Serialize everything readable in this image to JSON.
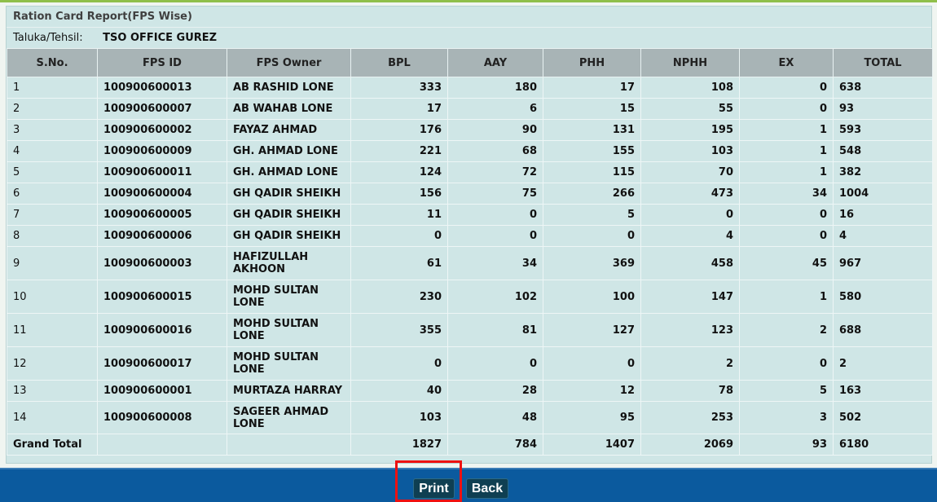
{
  "report": {
    "title": "Ration Card Report(FPS Wise)",
    "taluka_label": "Taluka/Tehsil:",
    "taluka_value": "TSO OFFICE GUREZ"
  },
  "table": {
    "headers": [
      "S.No.",
      "FPS ID",
      "FPS Owner",
      "BPL",
      "AAY",
      "PHH",
      "NPHH",
      "EX",
      "TOTAL"
    ],
    "rows": [
      [
        "1",
        "100900600013",
        "AB RASHID LONE",
        "333",
        "180",
        "17",
        "108",
        "0",
        "638"
      ],
      [
        "2",
        "100900600007",
        "AB WAHAB LONE",
        "17",
        "6",
        "15",
        "55",
        "0",
        "93"
      ],
      [
        "3",
        "100900600002",
        "FAYAZ AHMAD",
        "176",
        "90",
        "131",
        "195",
        "1",
        "593"
      ],
      [
        "4",
        "100900600009",
        "GH. AHMAD LONE",
        "221",
        "68",
        "155",
        "103",
        "1",
        "548"
      ],
      [
        "5",
        "100900600011",
        "GH. AHMAD LONE",
        "124",
        "72",
        "115",
        "70",
        "1",
        "382"
      ],
      [
        "6",
        "100900600004",
        "GH QADIR SHEIKH",
        "156",
        "75",
        "266",
        "473",
        "34",
        "1004"
      ],
      [
        "7",
        "100900600005",
        "GH QADIR SHEIKH",
        "11",
        "0",
        "5",
        "0",
        "0",
        "16"
      ],
      [
        "8",
        "100900600006",
        "GH QADIR SHEIKH",
        "0",
        "0",
        "0",
        "4",
        "0",
        "4"
      ],
      [
        "9",
        "100900600003",
        "HAFIZULLAH AKHOON",
        "61",
        "34",
        "369",
        "458",
        "45",
        "967"
      ],
      [
        "10",
        "100900600015",
        "MOHD SULTAN LONE",
        "230",
        "102",
        "100",
        "147",
        "1",
        "580"
      ],
      [
        "11",
        "100900600016",
        "MOHD SULTAN LONE",
        "355",
        "81",
        "127",
        "123",
        "2",
        "688"
      ],
      [
        "12",
        "100900600017",
        "MOHD SULTAN LONE",
        "0",
        "0",
        "0",
        "2",
        "0",
        "2"
      ],
      [
        "13",
        "100900600001",
        "MURTAZA HARRAY",
        "40",
        "28",
        "12",
        "78",
        "5",
        "163"
      ],
      [
        "14",
        "100900600008",
        "SAGEER AHMAD LONE",
        "103",
        "48",
        "95",
        "253",
        "3",
        "502"
      ]
    ],
    "grand_total": [
      "Grand Total",
      "",
      "",
      "1827",
      "784",
      "1407",
      "2069",
      "93",
      "6180"
    ]
  },
  "footer": {
    "print_label": "Print",
    "back_label": "Back"
  },
  "colors": {
    "accent_link": "#1a1ad1",
    "footer_bar": "#0b5a9e",
    "highlight": "#ee1111"
  }
}
